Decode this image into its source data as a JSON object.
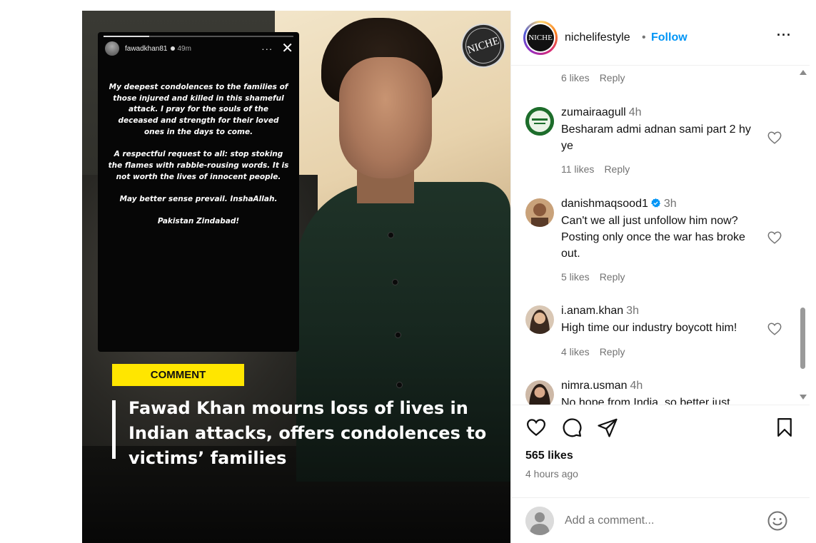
{
  "post": {
    "story": {
      "username": "fawadkhan81",
      "time": "49m",
      "more": "···",
      "close": "✕",
      "paragraphs": [
        "My deepest condolences to the families of those injured and killed in this shameful attack. I pray for the souls of the deceased and strength for their loved ones in the days to come.",
        "A respectful request to all: stop stoking the flames with rabble-rousing words. It is not worth the lives of innocent people.",
        "May better sense prevail. InshaAllah.",
        "Pakistan Zindabad!"
      ]
    },
    "badge": "NICHE",
    "tag": "COMMENT",
    "headline": "Fawad Khan mourns loss of lives in Indian attacks, offers condolences to victims’ families"
  },
  "header": {
    "avatar_logo": "NICHE",
    "username": "nichelifestyle",
    "separator": "•",
    "follow_label": "Follow",
    "more": "···"
  },
  "comments": {
    "top_meta": {
      "likes": "6 likes",
      "reply": "Reply"
    },
    "items": [
      {
        "username": "zumairaagull",
        "time": "4h",
        "verified": false,
        "text": "Besharam admi adnan sami part 2 hy ye",
        "likes": "11 likes",
        "reply": "Reply"
      },
      {
        "username": "danishmaqsood1",
        "time": "3h",
        "verified": true,
        "text": "Can't we all just unfollow him now? Posting only once the war has broke out.",
        "likes": "5 likes",
        "reply": "Reply"
      },
      {
        "username": "i.anam.khan",
        "time": "3h",
        "verified": false,
        "text": "High time our industry boycott him!",
        "likes": "4 likes",
        "reply": "Reply"
      },
      {
        "username": "nimra.usman",
        "time": "4h",
        "verified": false,
        "text": "No hope from India, so better just",
        "likes": "",
        "reply": ""
      }
    ]
  },
  "actions": {
    "likes": "565 likes",
    "time": "4 hours ago"
  },
  "add_comment": {
    "placeholder": "Add a comment..."
  },
  "colors": {
    "accent": "#0095f6",
    "verified": "#0095f6",
    "tag_yellow": "#ffe600",
    "muted": "#737373"
  },
  "icons": {
    "heart": "heart-icon",
    "comment": "comment-icon",
    "share": "paper-plane-icon",
    "save": "bookmark-icon",
    "emoji": "smiley-icon",
    "verified": "verified-badge-icon"
  }
}
